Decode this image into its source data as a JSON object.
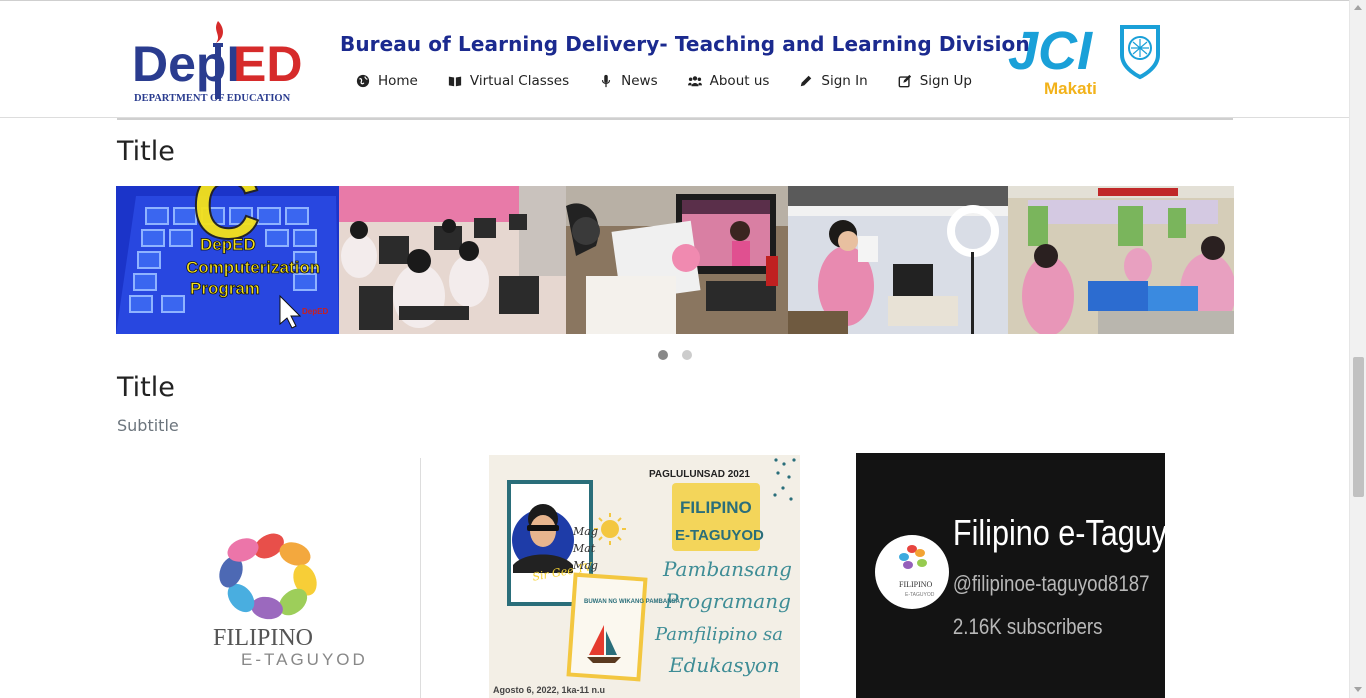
{
  "header": {
    "site_title": "Bureau of Learning Delivery- Teaching and Learning Division",
    "deped_logo": {
      "brand": "DepED",
      "caption": "DEPARTMENT OF EDUCATION"
    },
    "jci_logo": {
      "brand": "JCI",
      "city": "Makati"
    },
    "nav": [
      {
        "label": "Home",
        "icon": "globe-icon"
      },
      {
        "label": "Virtual Classes",
        "icon": "book-open-icon"
      },
      {
        "label": "News",
        "icon": "microphone-icon"
      },
      {
        "label": "About us",
        "icon": "users-icon"
      },
      {
        "label": "Sign In",
        "icon": "pencil-icon"
      },
      {
        "label": "Sign Up",
        "icon": "edit-icon"
      }
    ]
  },
  "section1": {
    "title": "Title",
    "slides": [
      {
        "name": "deped-computerization-program",
        "lines": [
          "DepED",
          "Computerization",
          "Program"
        ],
        "badge": "DepED"
      },
      {
        "name": "students-computer-lab"
      },
      {
        "name": "teacher-online-class"
      },
      {
        "name": "teacher-video-recording"
      },
      {
        "name": "teachers-laptops-room"
      }
    ],
    "active_slide_page": 1,
    "slide_pages": 2
  },
  "section2": {
    "title": "Title",
    "subtitle": "Subtitle",
    "cards": [
      {
        "name": "filipino-etaguyod-logo",
        "line1": "FILIPINO",
        "line2": "E-TAGUYOD"
      },
      {
        "name": "paglulunsad-poster",
        "top_label": "PAGLULUNSAD 2021",
        "badge_line1": "FILIPINO",
        "badge_line2": "E-TAGUYOD",
        "script_lines": [
          "Pambansang",
          "Programang",
          "Pamfilipino sa",
          "Edukasyon"
        ],
        "date": "Agosto 6, 2022, 1ka-11 n.u",
        "side_words": [
          "Mag",
          "Mat",
          "Mag"
        ],
        "mini_title": "BUWAN NG WIKANG PAMBANSA"
      },
      {
        "name": "youtube-channel-card",
        "channel": "Filipino e-Taguyod",
        "handle": "@filipinoe-taguyod8187",
        "subscribers": "2.16K subscribers"
      }
    ]
  }
}
